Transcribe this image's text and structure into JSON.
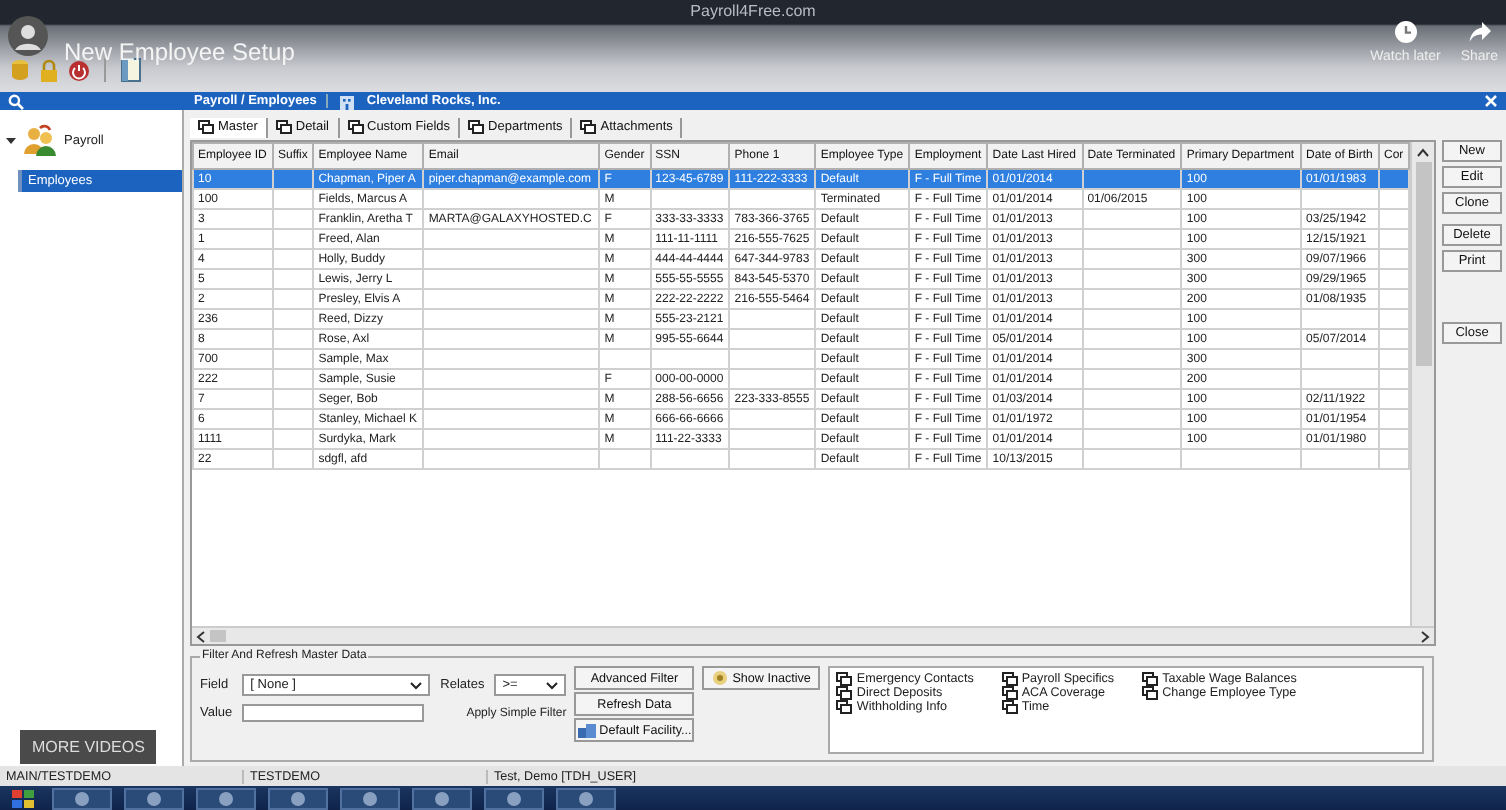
{
  "app_title": "Payroll4Free.com",
  "video_overlay": {
    "title": "New Employee Setup",
    "watch_later": "Watch later",
    "share": "Share",
    "more_videos": "MORE VIDEOS"
  },
  "breadcrumb": "Payroll / Employees",
  "company": "Cleveland Rocks, Inc.",
  "sidebar": {
    "items": [
      {
        "label": "Payroll",
        "expanded": true,
        "children": [
          {
            "label": "Employees",
            "selected": true
          }
        ]
      }
    ]
  },
  "tabs": [
    {
      "label": "Master",
      "selected": true
    },
    {
      "label": "Detail",
      "selected": false
    },
    {
      "label": "Custom Fields",
      "selected": false
    },
    {
      "label": "Departments",
      "selected": false
    },
    {
      "label": "Attachments",
      "selected": false
    }
  ],
  "table": {
    "columns": [
      "Employee ID",
      "Suffix",
      "Employee Name",
      "Email",
      "Gender",
      "SSN",
      "Phone 1",
      "Employee Type",
      "Employment",
      "Date Last Hired",
      "Date Terminated",
      "Primary Department",
      "Date of Birth",
      "Cor"
    ],
    "rows": [
      {
        "selected": true,
        "cells": [
          "10",
          null,
          "Chapman, Piper A",
          "piper.chapman@example.com",
          "F",
          "123-45-6789",
          "111-222-3333",
          "Default",
          "F - Full Time",
          "01/01/2014",
          null,
          "100",
          "01/01/1983",
          null
        ]
      },
      {
        "selected": false,
        "cells": [
          "100",
          null,
          "Fields, Marcus A",
          null,
          "M",
          null,
          null,
          "Terminated",
          "F - Full Time",
          "01/01/2014",
          "01/06/2015",
          "100",
          null,
          null
        ]
      },
      {
        "selected": false,
        "cells": [
          "3",
          null,
          "Franklin, Aretha T",
          "MARTA@GALAXYHOSTED.C",
          "F",
          "333-33-3333",
          "783-366-3765",
          "Default",
          "F - Full Time",
          "01/01/2013",
          null,
          "100",
          "03/25/1942",
          null
        ]
      },
      {
        "selected": false,
        "cells": [
          "1",
          null,
          "Freed, Alan",
          null,
          "M",
          "111-11-1111",
          "216-555-7625",
          "Default",
          "F - Full Time",
          "01/01/2013",
          null,
          "100",
          "12/15/1921",
          null
        ]
      },
      {
        "selected": false,
        "cells": [
          "4",
          null,
          "Holly, Buddy",
          null,
          "M",
          "444-44-4444",
          "647-344-9783",
          "Default",
          "F - Full Time",
          "01/01/2013",
          null,
          "300",
          "09/07/1966",
          null
        ]
      },
      {
        "selected": false,
        "cells": [
          "5",
          null,
          "Lewis, Jerry L",
          null,
          "M",
          "555-55-5555",
          "843-545-5370",
          "Default",
          "F - Full Time",
          "01/01/2013",
          null,
          "300",
          "09/29/1965",
          null
        ]
      },
      {
        "selected": false,
        "cells": [
          "2",
          null,
          "Presley, Elvis A",
          null,
          "M",
          "222-22-2222",
          "216-555-5464",
          "Default",
          "F - Full Time",
          "01/01/2013",
          null,
          "200",
          "01/08/1935",
          null
        ]
      },
      {
        "selected": false,
        "cells": [
          "236",
          null,
          "Reed, Dizzy",
          null,
          "M",
          "555-23-2121",
          null,
          "Default",
          "F - Full Time",
          "01/01/2014",
          null,
          "100",
          null,
          null
        ]
      },
      {
        "selected": false,
        "cells": [
          "8",
          null,
          "Rose, Axl",
          null,
          "M",
          "995-55-6644",
          null,
          "Default",
          "F - Full Time",
          "05/01/2014",
          null,
          "100",
          "05/07/2014",
          null
        ]
      },
      {
        "selected": false,
        "cells": [
          "700",
          null,
          "Sample, Max",
          null,
          null,
          null,
          null,
          "Default",
          "F - Full Time",
          "01/01/2014",
          null,
          "300",
          null,
          null
        ]
      },
      {
        "selected": false,
        "cells": [
          "222",
          null,
          "Sample, Susie",
          null,
          "F",
          "000-00-0000",
          null,
          "Default",
          "F - Full Time",
          "01/01/2014",
          null,
          "200",
          null,
          null
        ]
      },
      {
        "selected": false,
        "cells": [
          "7",
          null,
          "Seger, Bob",
          null,
          "M",
          "288-56-6656",
          "223-333-8555",
          "Default",
          "F - Full Time",
          "01/03/2014",
          null,
          "100",
          "02/11/1922",
          null
        ]
      },
      {
        "selected": false,
        "cells": [
          "6",
          null,
          "Stanley, Michael K",
          null,
          "M",
          "666-66-6666",
          null,
          "Default",
          "F - Full Time",
          "01/01/1972",
          null,
          "100",
          "01/01/1954",
          null
        ]
      },
      {
        "selected": false,
        "cells": [
          "1111",
          null,
          "Surdyka, Mark",
          null,
          "M",
          "111-22-3333",
          null,
          "Default",
          "F - Full Time",
          "01/01/2014",
          null,
          "100",
          "01/01/1980",
          null
        ]
      },
      {
        "selected": false,
        "cells": [
          "22",
          null,
          "sdgfl, afd",
          null,
          null,
          null,
          null,
          "Default",
          "F - Full Time",
          "10/13/2015",
          null,
          null,
          null,
          null
        ]
      }
    ]
  },
  "side_buttons": [
    [
      "New",
      "Edit",
      "Clone"
    ],
    [
      "Delete",
      "Print"
    ],
    [
      "Close"
    ]
  ],
  "filter": {
    "title": "Filter And Refresh Master Data",
    "field_label": "Field",
    "field_value": "[ None ]",
    "relates_label": "Relates",
    "relates_value": ">=",
    "value_label": "Value",
    "apply": "Apply Simple Filter",
    "buttons": [
      "Advanced Filter",
      "Refresh Data"
    ],
    "facility_button": "Default Facility...",
    "show_inactive": "Show Inactive"
  },
  "links": [
    "Emergency Contacts",
    "Direct Deposits",
    "Withholding Info",
    "Payroll Specifics",
    "ACA Coverage",
    "Time",
    "Taxable Wage Balances",
    "Change Employee Type"
  ],
  "status_bar": [
    "MAIN/TESTDEMO",
    "TESTDEMO",
    "Test, Demo [TDH_USER]"
  ]
}
